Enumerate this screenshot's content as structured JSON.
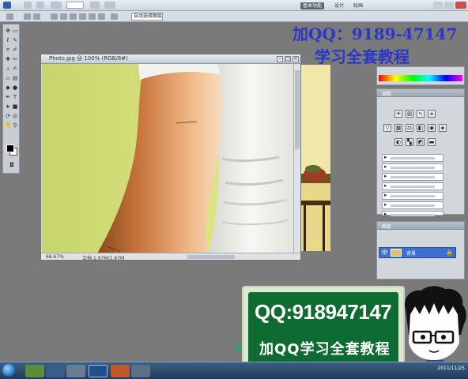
{
  "app": {
    "workspace_label": "基本功能",
    "workspace_tabs": [
      "设计",
      "绘画"
    ],
    "zoom_option": "100%"
  },
  "options_bar": {
    "style_label": "自动选择图层"
  },
  "document": {
    "title": "Photo.jpg @ 100% (RGB/8#)",
    "status_zoom": "66.67%",
    "status_doc": "文档:1.97M/1.97M"
  },
  "right_panel": {
    "adjustments_title": "调整",
    "presets": [
      "色阶预设",
      "曲线预设",
      "曝光度预设",
      "色相/饱和度预设",
      "黑白预设",
      "通道混合器预设",
      "可选颜色预设"
    ],
    "layers_title": "图层",
    "layer_name": "背景"
  },
  "watermark": {
    "line1": "加QQ：9189-47147",
    "line2": "学习全套教程"
  },
  "banner": {
    "line1": "QQ:918947147",
    "line2": "加QQ学习全套教程"
  },
  "taskbar": {
    "clock": "2011/11/25"
  },
  "colors": {
    "watermark": "#2a37c8",
    "banner_bg": "#0e6b32",
    "canvas_bg": "#d7e07d",
    "selected_layer": "#3b6fd0"
  }
}
